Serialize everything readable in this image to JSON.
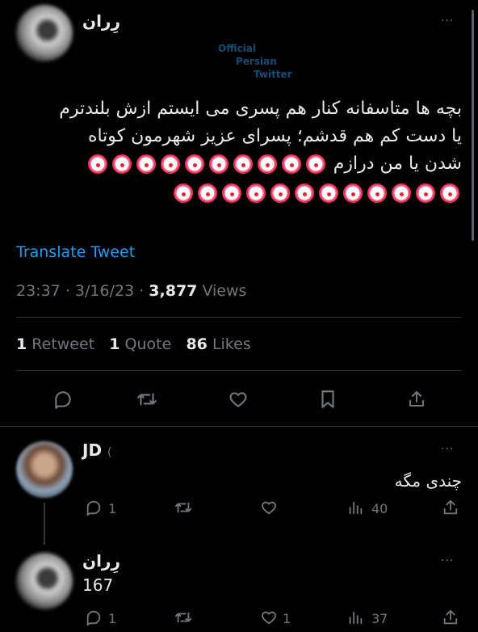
{
  "main_tweet": {
    "author_name": "رِران",
    "more": "···",
    "text_lines": [
      "بچه ها متاسفانه کنار هم پسری می ایستم ازش بلندترم",
      "یا دست کم هم قدشم؛ پسرای عزیز شهرمون کوتاه",
      "شدن یا من درازم"
    ],
    "emoji": "clown-face",
    "emoji_row3_count": 10,
    "emoji_row4_count": 12,
    "translate_label": "Translate Tweet",
    "time": "23:37",
    "date": "3/16/23",
    "views_count": "3,877",
    "views_label": "Views",
    "retweets_count": "1",
    "retweets_label": "Retweet",
    "quotes_count": "1",
    "quotes_label": "Quote",
    "likes_count": "86",
    "likes_label": "Likes",
    "sep": "·"
  },
  "watermark": {
    "line1": "Official",
    "line2": "Persian",
    "line3": "Twitter"
  },
  "replies": [
    {
      "author_name": "JD",
      "text": "چندی مگه",
      "reply_count": "1",
      "like_count": "",
      "views_count": "40"
    },
    {
      "author_name": "رِران",
      "text": "167",
      "reply_count": "1",
      "like_count": "1",
      "views_count": "37"
    }
  ],
  "colors": {
    "background": "#000000",
    "text": "#e7e9ea",
    "muted": "#71767b",
    "link": "#1d9bf0",
    "divider": "#2f3336"
  }
}
